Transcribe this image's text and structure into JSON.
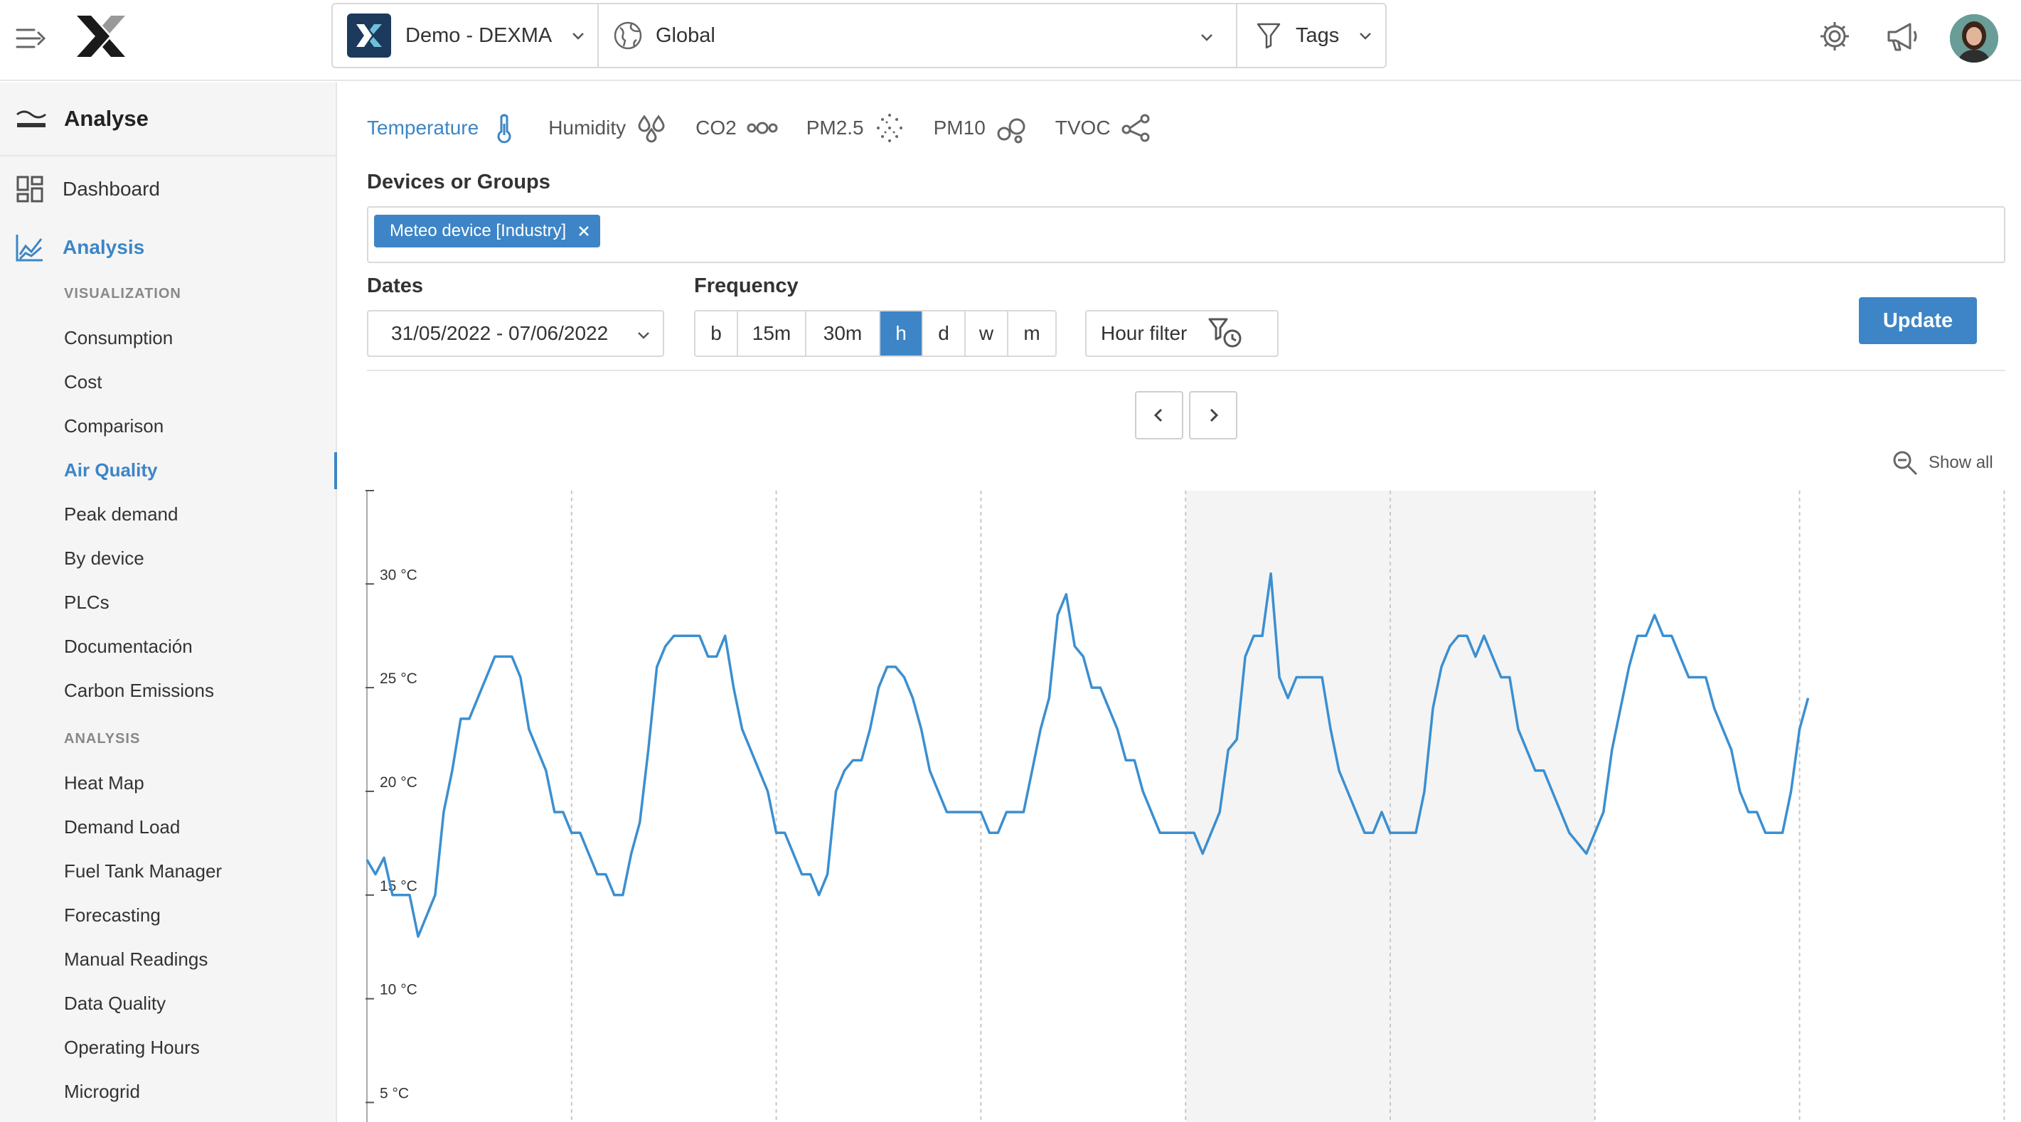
{
  "topbar": {
    "account_label": "Demo - DEXMA",
    "location_label": "Global",
    "tags_label": "Tags"
  },
  "sidebar": {
    "header": "Analyse",
    "dashboard": "Dashboard",
    "analysis": "Analysis",
    "visualization_title": "VISUALIZATION",
    "visualization_items": [
      "Consumption",
      "Cost",
      "Comparison",
      "Air Quality",
      "Peak demand",
      "By device",
      "PLCs",
      "Documentación",
      "Carbon Emissions"
    ],
    "analysis_title": "ANALYSIS",
    "analysis_items": [
      "Heat Map",
      "Demand Load",
      "Fuel Tank Manager",
      "Forecasting",
      "Manual Readings",
      "Data Quality",
      "Operating Hours",
      "Microgrid"
    ]
  },
  "metric_tabs": [
    {
      "label": "Temperature",
      "icon": "thermometer-icon",
      "active": true
    },
    {
      "label": "Humidity",
      "icon": "droplets-icon",
      "active": false
    },
    {
      "label": "CO2",
      "icon": "molecule-icon",
      "active": false
    },
    {
      "label": "PM2.5",
      "icon": "particles-icon",
      "active": false
    },
    {
      "label": "PM10",
      "icon": "bubbles-icon",
      "active": false
    },
    {
      "label": "TVOC",
      "icon": "share-icon",
      "active": false
    }
  ],
  "filters": {
    "devices_label": "Devices or Groups",
    "device_chip": "Meteo device [Industry]",
    "dates_label": "Dates",
    "dates_value": "31/05/2022 - 07/06/2022",
    "frequency_label": "Frequency",
    "frequency_options": [
      "b",
      "15m",
      "30m",
      "h",
      "d",
      "w",
      "m"
    ],
    "frequency_selected": "h",
    "hour_filter_label": "Hour filter",
    "update_label": "Update"
  },
  "chart_controls": {
    "show_all_label": "Show all"
  },
  "colors": {
    "accent": "#3d85c6",
    "line": "#3b8fd0",
    "weekend_band": "#f4f4f4"
  },
  "chart_data": {
    "type": "line",
    "ylabel": "",
    "yticks": [
      "30 °C",
      "25 °C",
      "20 °C",
      "15 °C",
      "10 °C",
      "5 °C"
    ],
    "ytick_values": [
      30,
      25,
      20,
      15,
      10,
      5
    ],
    "ylim": [
      2,
      34.5
    ],
    "days": 8,
    "weekend_days": [
      4,
      5
    ],
    "grid": "vertical-dashed-day-separators",
    "series": [
      {
        "values": [
          16.7,
          16.0,
          16.8,
          15.0,
          15.0,
          15.0,
          13.0,
          14.0,
          15.0,
          19.0,
          21.0,
          23.5,
          23.5,
          24.5,
          25.5,
          26.5,
          26.5,
          26.5,
          25.5,
          23.0,
          22.0,
          21.0,
          19.0,
          19.0,
          18.0,
          18.0,
          17.0,
          16.0,
          16.0,
          15.0,
          15.0,
          17.0,
          18.5,
          22.0,
          26.0,
          27.0,
          27.5,
          27.5,
          27.5,
          27.5,
          26.5,
          26.5,
          27.5,
          25.0,
          23.0,
          22.0,
          21.0,
          20.0,
          18.0,
          18.0,
          17.0,
          16.0,
          16.0,
          15.0,
          16.0,
          20.0,
          21.0,
          21.5,
          21.5,
          23.0,
          25.0,
          26.0,
          26.0,
          25.5,
          24.5,
          23.0,
          21.0,
          20.0,
          19.0,
          19.0,
          19.0,
          19.0,
          19.0,
          18.0,
          18.0,
          19.0,
          19.0,
          19.0,
          21.0,
          23.0,
          24.5,
          28.5,
          29.5,
          27.0,
          26.5,
          25.0,
          25.0,
          24.0,
          23.0,
          21.5,
          21.5,
          20.0,
          19.0,
          18.0,
          18.0,
          18.0,
          18.0,
          18.0,
          17.0,
          18.0,
          19.0,
          22.0,
          22.5,
          26.5,
          27.5,
          27.5,
          30.5,
          25.5,
          24.5,
          25.5,
          25.5,
          25.5,
          25.5,
          23.0,
          21.0,
          20.0,
          19.0,
          18.0,
          18.0,
          19.0,
          18.0,
          18.0,
          18.0,
          18.0,
          20.0,
          24.0,
          26.0,
          27.0,
          27.5,
          27.5,
          26.5,
          27.5,
          26.5,
          25.5,
          25.5,
          23.0,
          22.0,
          21.0,
          21.0,
          20.0,
          19.0,
          18.0,
          17.5,
          17.0,
          18.0,
          19.0,
          22.0,
          24.0,
          26.0,
          27.5,
          27.5,
          28.5,
          27.5,
          27.5,
          26.5,
          25.5,
          25.5,
          25.5,
          24.0,
          23.0,
          22.0,
          20.0,
          19.0,
          19.0,
          18.0,
          18.0,
          18.0,
          20.0,
          23.0,
          24.5
        ]
      }
    ]
  }
}
